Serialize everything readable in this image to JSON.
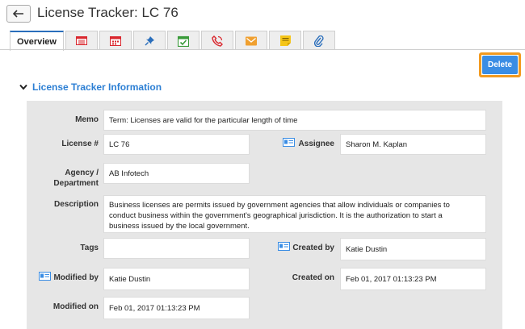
{
  "header": {
    "title": "License Tracker: LC 76"
  },
  "tabs": [
    {
      "id": "overview",
      "label": "Overview",
      "icon": null
    },
    {
      "id": "details",
      "icon": "list-icon",
      "color": "#d9272e"
    },
    {
      "id": "calendar",
      "icon": "calendar-icon",
      "color": "#d9272e"
    },
    {
      "id": "pin",
      "icon": "pin-icon",
      "color": "#2a6ebb"
    },
    {
      "id": "tasks",
      "icon": "task-check-icon",
      "color": "#3a9a3a"
    },
    {
      "id": "calls",
      "icon": "phone-icon",
      "color": "#d9272e"
    },
    {
      "id": "email",
      "icon": "email-icon",
      "color": "#f0a030"
    },
    {
      "id": "notes",
      "icon": "note-icon",
      "color": "#f5c518"
    },
    {
      "id": "attachments",
      "icon": "paperclip-icon",
      "color": "#2a6ebb"
    }
  ],
  "actions": {
    "delete_label": "Delete"
  },
  "section": {
    "title": "License Tracker Information"
  },
  "fields": {
    "memo": {
      "label": "Memo",
      "value": "Term: Licenses are valid for the particular length of time"
    },
    "license_no": {
      "label": "License #",
      "value": "LC 76"
    },
    "assignee": {
      "label": "Assignee",
      "value": "Sharon M. Kaplan"
    },
    "agency": {
      "label_line1": "Agency /",
      "label_line2": "Department",
      "value": "AB Infotech"
    },
    "description": {
      "label": "Description",
      "line1": "Business licenses are permits issued by government agencies that allow individuals or companies to",
      "line2": "conduct business within the government's geographical jurisdiction. It is the authorization to start a",
      "line3": "business issued by the local government."
    },
    "tags": {
      "label": "Tags",
      "value": ""
    },
    "created_by": {
      "label": "Created by",
      "value": "Katie Dustin"
    },
    "modified_by": {
      "label": "Modified by",
      "value": "Katie Dustin"
    },
    "created_on": {
      "label": "Created on",
      "value": "Feb 01, 2017 01:13:23 PM"
    },
    "modified_on": {
      "label": "Modified on",
      "value": "Feb 01, 2017 01:13:23 PM"
    }
  }
}
